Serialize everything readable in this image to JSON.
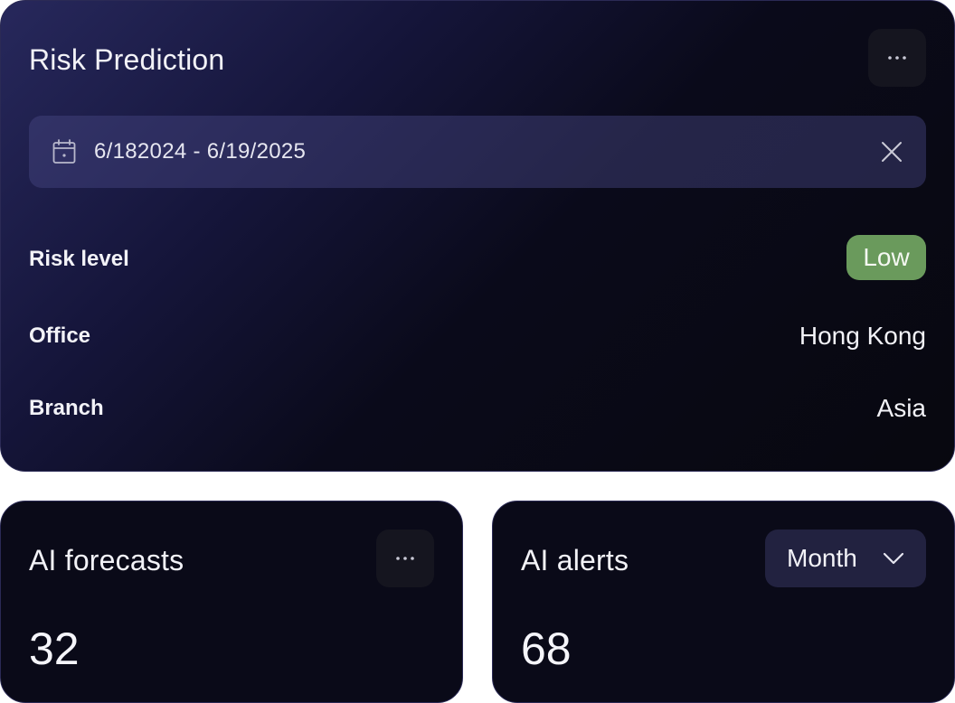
{
  "risk_card": {
    "title": "Risk Prediction",
    "date_range": "6/182024 - 6/19/2025",
    "rows": [
      {
        "label": "Risk level",
        "value": "Low"
      },
      {
        "label": "Office",
        "value": "Hong Kong"
      },
      {
        "label": "Branch",
        "value": "Asia"
      }
    ],
    "risk_badge_color": "#6a9a5c"
  },
  "forecast_card": {
    "title": "AI forecasts",
    "value": "32"
  },
  "alerts_card": {
    "title": "AI alerts",
    "value": "68",
    "period_selected": "Month"
  },
  "icons": {
    "more": "more-horizontal-icon",
    "calendar": "calendar-icon",
    "clear": "close-icon",
    "dropdown": "chevron-down-icon"
  }
}
